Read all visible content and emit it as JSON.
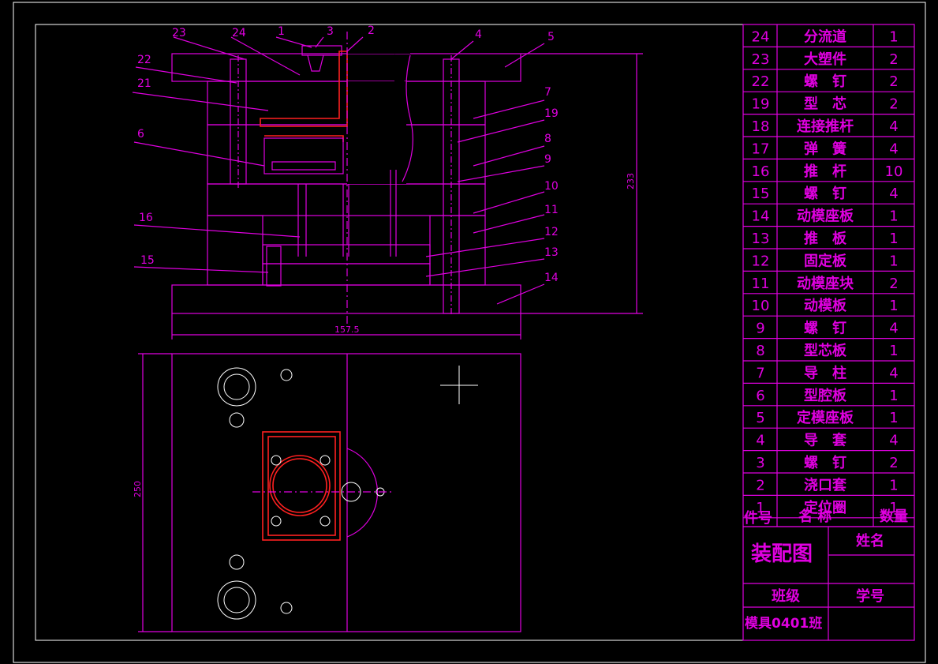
{
  "drawing": {
    "title": "装配图",
    "name_label": "姓名",
    "class_label": "班级",
    "student_id_label": "学号",
    "class_value": "模具0401班"
  },
  "dimensions": {
    "width": "157.5",
    "height": "233",
    "plan_height": "250"
  },
  "part_leaders": [
    "23",
    "24",
    "1",
    "3",
    "2",
    "4",
    "5",
    "22",
    "21",
    "6",
    "7",
    "19",
    "8",
    "9",
    "10",
    "11",
    "16",
    "12",
    "15",
    "13",
    "14"
  ],
  "bom": {
    "headers": {
      "no": "件号",
      "name": "名 称",
      "qty": "数量"
    },
    "rows": [
      {
        "no": "24",
        "name": "分流道",
        "qty": "1"
      },
      {
        "no": "23",
        "name": "大塑件",
        "qty": "2"
      },
      {
        "no": "22",
        "name": "螺　钉",
        "qty": "2"
      },
      {
        "no": "19",
        "name": "型　芯",
        "qty": "2"
      },
      {
        "no": "18",
        "name": "连接推杆",
        "qty": "4"
      },
      {
        "no": "17",
        "name": "弹　簧",
        "qty": "4"
      },
      {
        "no": "16",
        "name": "推　杆",
        "qty": "10"
      },
      {
        "no": "15",
        "name": "螺　钉",
        "qty": "4"
      },
      {
        "no": "14",
        "name": "动模座板",
        "qty": "1"
      },
      {
        "no": "13",
        "name": "推　板",
        "qty": "1"
      },
      {
        "no": "12",
        "name": "固定板",
        "qty": "1"
      },
      {
        "no": "11",
        "name": "动模座块",
        "qty": "2"
      },
      {
        "no": "10",
        "name": "动模板",
        "qty": "1"
      },
      {
        "no": "9",
        "name": "螺　钉",
        "qty": "4"
      },
      {
        "no": "8",
        "name": "型芯板",
        "qty": "1"
      },
      {
        "no": "7",
        "name": "导　柱",
        "qty": "4"
      },
      {
        "no": "6",
        "name": "型腔板",
        "qty": "1"
      },
      {
        "no": "5",
        "name": "定模座板",
        "qty": "1"
      },
      {
        "no": "4",
        "name": "导　套",
        "qty": "4"
      },
      {
        "no": "3",
        "name": "螺　钉",
        "qty": "2"
      },
      {
        "no": "2",
        "name": "浇口套",
        "qty": "1"
      },
      {
        "no": "1",
        "name": "定位圈",
        "qty": "1"
      }
    ]
  },
  "colors": {
    "line": "#e000e0",
    "frame": "#ffffff",
    "part": "#ff2020",
    "background": "#000000"
  }
}
